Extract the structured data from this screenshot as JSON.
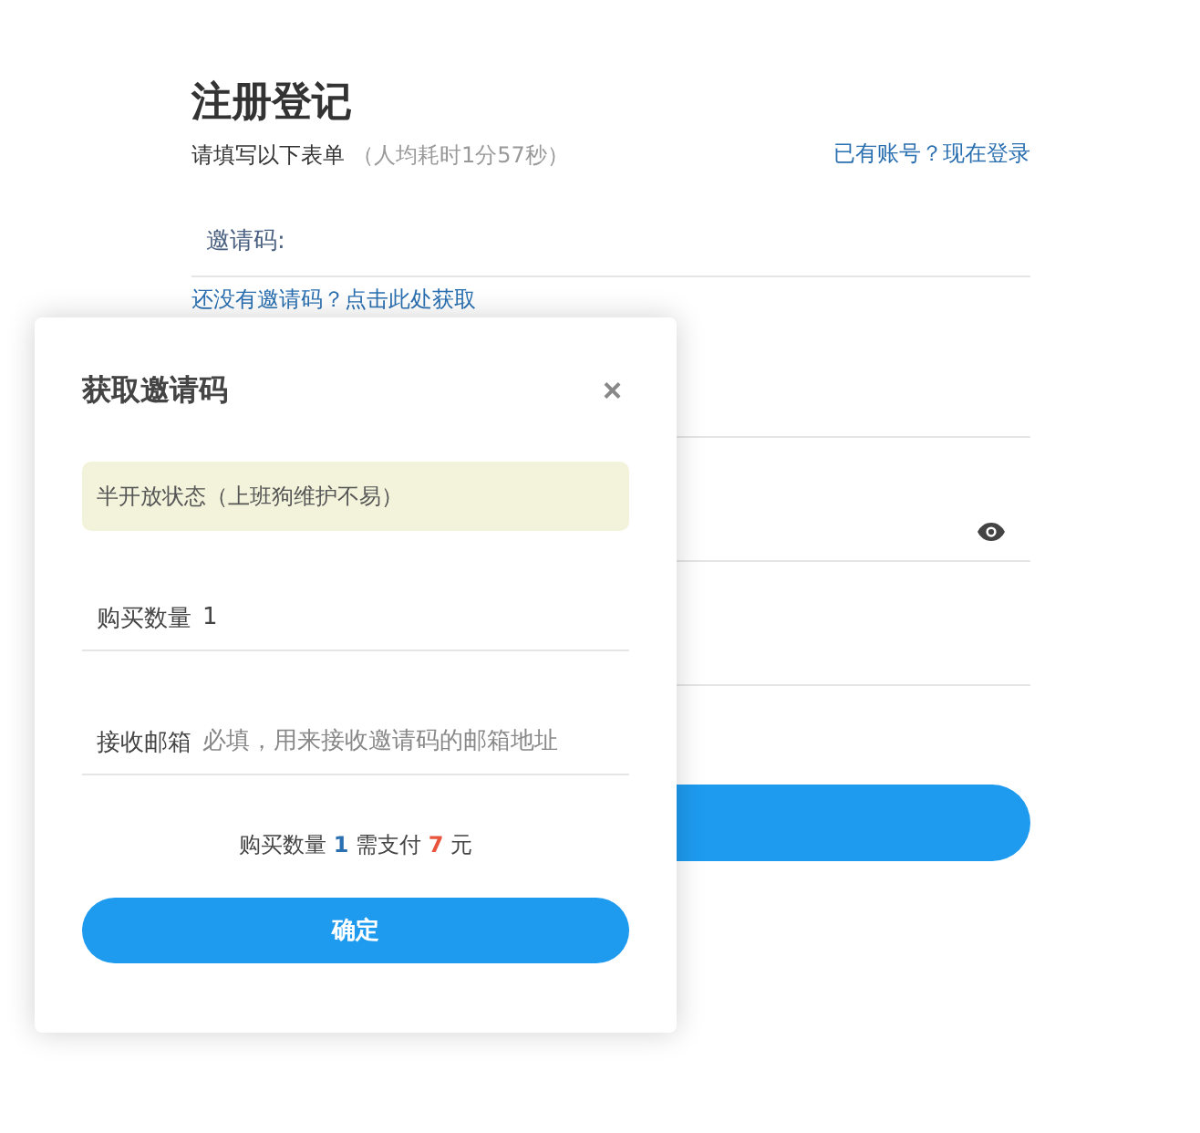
{
  "page": {
    "title": "注册登记",
    "subtitle": "请填写以下表单",
    "subtitle_note": "（人均耗时1分57秒）",
    "login_link": "已有账号？现在登录"
  },
  "form": {
    "invite_label": "邀请码:",
    "get_invite_link": "还没有邀请码？点击此处获取",
    "fields": [
      {
        "kind": "plain"
      },
      {
        "kind": "password"
      },
      {
        "kind": "plain"
      }
    ]
  },
  "dialog": {
    "title": "获取邀请码",
    "close": "×",
    "notice": "半开放状态（上班狗维护不易）",
    "quantity": {
      "label": "购买数量",
      "value": "1"
    },
    "email": {
      "label": "接收邮箱",
      "placeholder": "必填，用来接收邀请码的邮箱地址"
    },
    "summary": {
      "prefix": "购买数量",
      "quantity": "1",
      "middle": "需支付",
      "price": "7",
      "suffix": "元"
    },
    "confirm": "确定"
  }
}
